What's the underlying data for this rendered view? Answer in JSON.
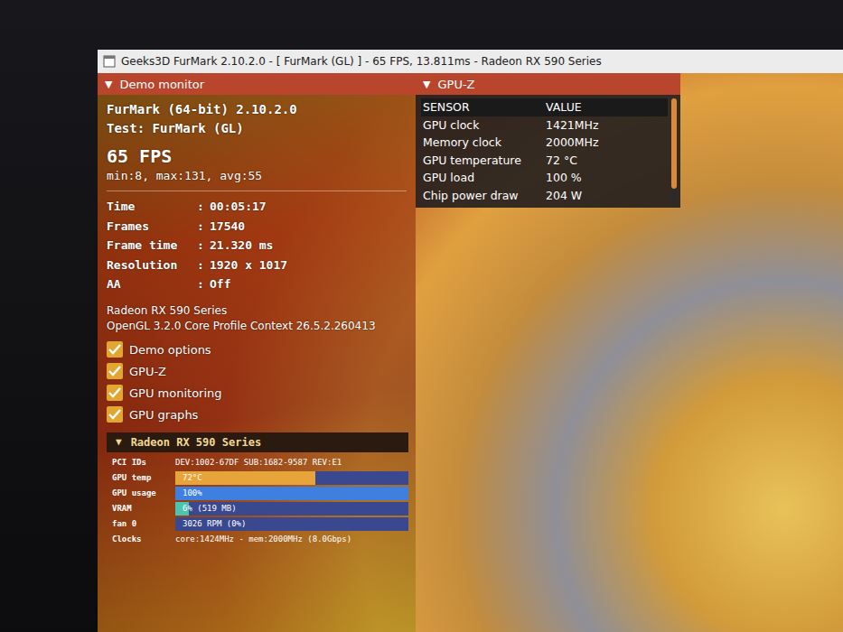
{
  "window": {
    "title": "Geeks3D FurMark 2.10.2.0 - [ FurMark (GL) ] - 65 FPS, 13.811ms - Radeon RX 590 Series"
  },
  "demo_monitor": {
    "toggle": "▼",
    "title": "Demo monitor",
    "app": "FurMark (64-bit) 2.10.2.0",
    "test": "Test: FurMark (GL)",
    "fps": "65 FPS",
    "fps_stats": "min:8, max:131, avg:55",
    "separator": ":",
    "stats": [
      {
        "label": "Time",
        "value": "00:05:17"
      },
      {
        "label": "Frames",
        "value": "17540"
      },
      {
        "label": "Frame time",
        "value": "21.320 ms"
      },
      {
        "label": "Resolution",
        "value": "1920 x 1017"
      },
      {
        "label": "AA",
        "value": "Off"
      }
    ],
    "gpu_name": "Radeon RX 590 Series",
    "gl_context": "OpenGL 3.2.0 Core Profile Context 26.5.2.260413",
    "options": [
      {
        "label": "Demo options",
        "checked": true
      },
      {
        "label": "GPU-Z",
        "checked": true
      },
      {
        "label": "GPU monitoring",
        "checked": true
      },
      {
        "label": "GPU graphs",
        "checked": true
      }
    ]
  },
  "gpu_section": {
    "toggle": "▼",
    "title": "Radeon RX 590 Series",
    "rows": [
      {
        "kind": "text",
        "label": "PCI IDs",
        "value": "DEV:1002-67DF SUB:1682-9587 REV:E1"
      },
      {
        "kind": "bar",
        "label": "GPU temp",
        "value": "72°C",
        "level": 0.6,
        "color": "#e6a43a"
      },
      {
        "kind": "bar",
        "label": "GPU usage",
        "value": "100%",
        "level": 1.0,
        "color": "#3f7fe0"
      },
      {
        "kind": "bar",
        "label": "VRAM",
        "value": "6% (519 MB)",
        "level": 0.06,
        "color": "#4cc4b0"
      },
      {
        "kind": "bar",
        "label": "fan 0",
        "value": "3026 RPM (0%)",
        "level": 0.0,
        "color": "#6a8ad0"
      },
      {
        "kind": "text",
        "label": "Clocks",
        "value": "core:1424MHz - mem:2000MHz (8.0Gbps)"
      }
    ]
  },
  "gpuz": {
    "toggle": "▼",
    "title": "GPU-Z",
    "columns": [
      "SENSOR",
      "VALUE"
    ],
    "rows": [
      {
        "sensor": "GPU clock",
        "value": "1421MHz"
      },
      {
        "sensor": "Memory clock",
        "value": "2000MHz"
      },
      {
        "sensor": "GPU temperature",
        "value": "72 °C"
      },
      {
        "sensor": "GPU load",
        "value": "100 %"
      },
      {
        "sensor": "Chip power draw",
        "value": "204 W"
      }
    ]
  }
}
